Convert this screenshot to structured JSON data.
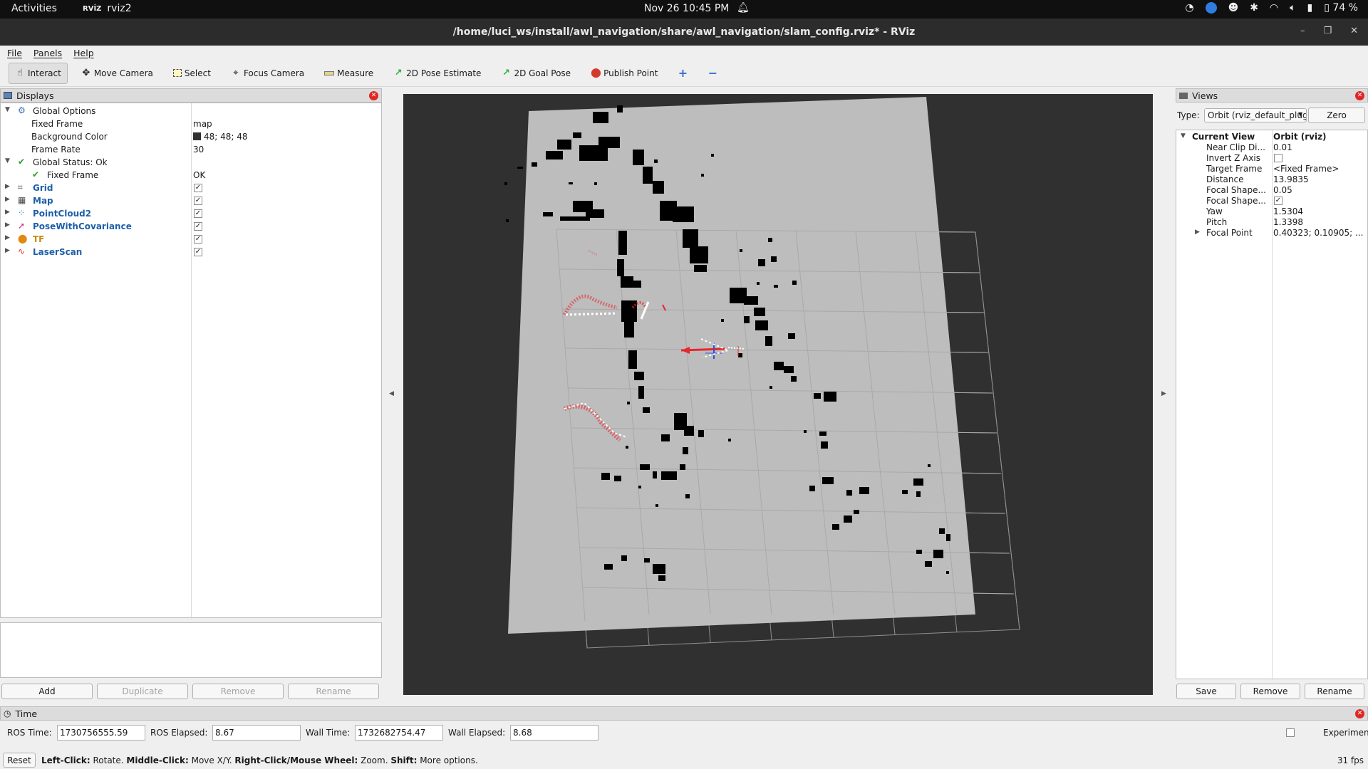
{
  "topbar": {
    "activities": "Activities",
    "app": "rviz2",
    "app_logo": "RVİZ",
    "clock": "Nov 26  10:45 PM",
    "battery": "74 %"
  },
  "window": {
    "title": "/home/luci_ws/install/awl_navigation/share/awl_navigation/slam_config.rviz* - RViz"
  },
  "menu": [
    "File",
    "Panels",
    "Help"
  ],
  "toolbar": {
    "interact": "Interact",
    "move_camera": "Move Camera",
    "select": "Select",
    "focus_camera": "Focus Camera",
    "measure": "Measure",
    "pose_estimate": "2D Pose Estimate",
    "goal_pose": "2D Goal Pose",
    "publish_point": "Publish Point"
  },
  "displays": {
    "title": "Displays",
    "global_options": "Global Options",
    "fixed_frame_label": "Fixed Frame",
    "fixed_frame_value": "map",
    "background_color_label": "Background Color",
    "background_color_value": "48; 48; 48",
    "background_color_hex": "#303030",
    "frame_rate_label": "Frame Rate",
    "frame_rate_value": "30",
    "global_status": "Global Status: Ok",
    "status_fixed_frame": "Fixed Frame",
    "status_fixed_frame_value": "OK",
    "items": [
      {
        "label": "Grid",
        "icon": "grid-icon",
        "enabled": true
      },
      {
        "label": "Map",
        "icon": "map-icon",
        "enabled": true
      },
      {
        "label": "PointCloud2",
        "icon": "pointcloud-icon",
        "enabled": true
      },
      {
        "label": "PoseWithCovariance",
        "icon": "pose-icon",
        "enabled": true
      },
      {
        "label": "TF",
        "icon": "tf-icon",
        "enabled": true
      },
      {
        "label": "LaserScan",
        "icon": "laserscan-icon",
        "enabled": true
      }
    ],
    "buttons": {
      "add": "Add",
      "duplicate": "Duplicate",
      "remove": "Remove",
      "rename": "Rename"
    }
  },
  "views": {
    "title": "Views",
    "type_label": "Type:",
    "type_value": "Orbit (rviz_default_plugins)",
    "zero": "Zero",
    "current_view": "Current View",
    "current_view_value": "Orbit (rviz)",
    "props": [
      {
        "label": "Near Clip Di...",
        "value": "0.01"
      },
      {
        "label": "Invert Z Axis",
        "value": ""
      },
      {
        "label": "Target Frame",
        "value": "<Fixed Frame>"
      },
      {
        "label": "Distance",
        "value": "13.9835"
      },
      {
        "label": "Focal Shape...",
        "value": "0.05"
      },
      {
        "label": "Focal Shape...",
        "value": ""
      },
      {
        "label": "Yaw",
        "value": "1.5304"
      },
      {
        "label": "Pitch",
        "value": "1.3398"
      },
      {
        "label": "Focal Point",
        "value": "0.40323; 0.10905; ..."
      }
    ],
    "buttons": {
      "save": "Save",
      "remove": "Remove",
      "rename": "Rename"
    }
  },
  "time": {
    "title": "Time",
    "ros_time_label": "ROS Time:",
    "ros_time": "1730756555.59",
    "ros_elapsed_label": "ROS Elapsed:",
    "ros_elapsed": "8.67",
    "wall_time_label": "Wall Time:",
    "wall_time": "1732682754.47",
    "wall_elapsed_label": "Wall Elapsed:",
    "wall_elapsed": "8.68",
    "experimental": "Experimental"
  },
  "status": {
    "reset": "Reset",
    "k1": "Left-Click:",
    "t1": " Rotate. ",
    "k2": "Middle-Click:",
    "t2": " Move X/Y. ",
    "k3": "Right-Click/Mouse Wheel:",
    "t3": " Zoom. ",
    "k4": "Shift:",
    "t4": " More options.",
    "fps": "31 fps"
  },
  "colors": {
    "viewport_bg": "#303030",
    "map_free": "#bdbdbd",
    "map_occupied": "#000000",
    "grid": "#a0a0a0",
    "laser": "#e8262b",
    "display_label": "#1f5fa8"
  }
}
